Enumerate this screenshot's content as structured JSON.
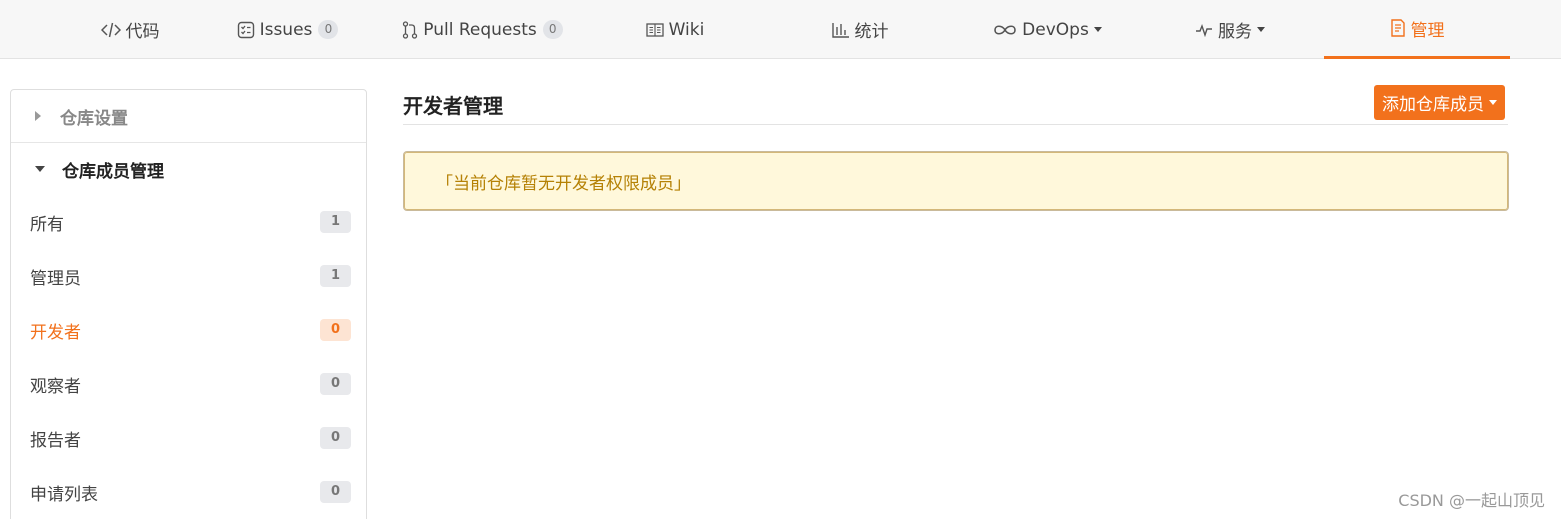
{
  "nav": {
    "tabs": [
      {
        "label": "代码",
        "icon": "code-icon"
      },
      {
        "label": "Issues",
        "icon": "issues-icon",
        "count": "0"
      },
      {
        "label": "Pull Requests",
        "icon": "pull-request-icon",
        "count": "0"
      },
      {
        "label": "Wiki",
        "icon": "wiki-book-icon"
      },
      {
        "label": "统计",
        "icon": "bar-chart-icon"
      },
      {
        "label": "DevOps",
        "icon": "infinity-icon"
      },
      {
        "label": "服务",
        "icon": "pulse-icon"
      },
      {
        "label": "管理",
        "icon": "manage-doc-icon"
      }
    ],
    "active_tab": "管理"
  },
  "sidebar": {
    "section_collapsed": "仓库设置",
    "section_open": "仓库成员管理",
    "items": [
      {
        "label": "所有",
        "count": "1"
      },
      {
        "label": "管理员",
        "count": "1"
      },
      {
        "label": "开发者",
        "count": "0"
      },
      {
        "label": "观察者",
        "count": "0"
      },
      {
        "label": "报告者",
        "count": "0"
      },
      {
        "label": "申请列表",
        "count": "0"
      }
    ],
    "active_item": "开发者"
  },
  "main": {
    "title": "开发者管理",
    "add_button": "添加仓库成员",
    "notice": "「当前仓库暂无开发者权限成员」"
  },
  "watermark": "CSDN @一起山顶见",
  "colors": {
    "accent": "#f2711c",
    "notice_bg": "#fff8db",
    "notice_text": "#b58105"
  }
}
